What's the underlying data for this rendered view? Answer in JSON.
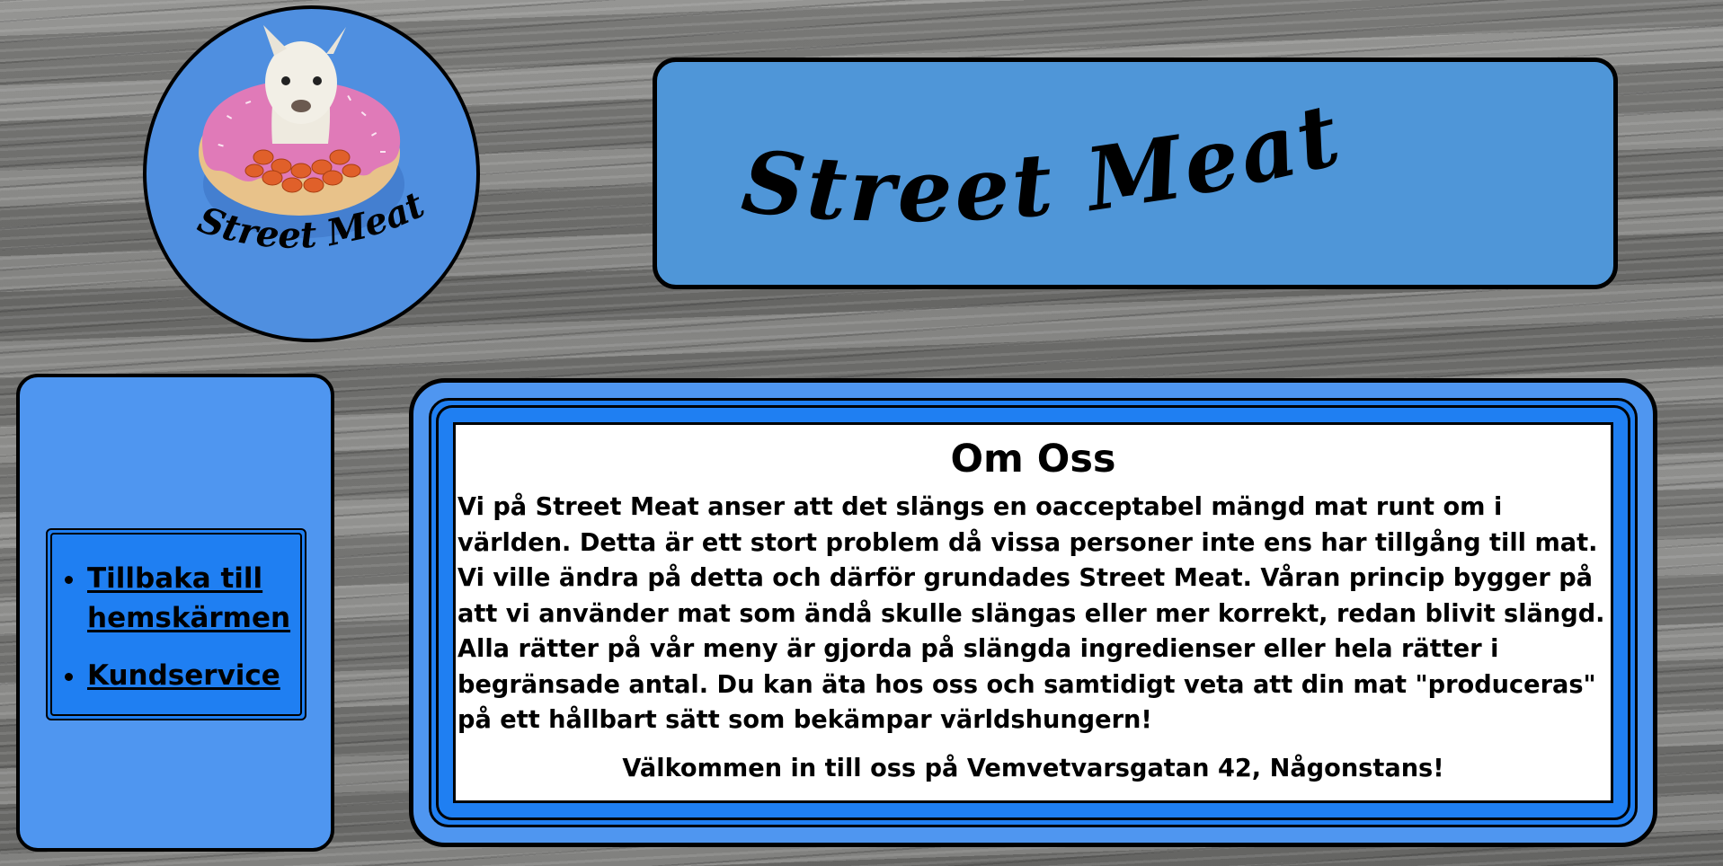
{
  "logo": {
    "text": "Street Meat",
    "image": "alpaca-in-donut-with-beans-icon"
  },
  "header": {
    "title": "Street Meat"
  },
  "nav": {
    "items": [
      {
        "label": "Tillbaka till hemskärmen"
      },
      {
        "label": "Kundservice"
      }
    ]
  },
  "about": {
    "title": "Om Oss",
    "text": "Vi på Street Meat anser att det slängs en oacceptabel mängd mat runt om i världen. Detta är ett stort problem då vissa personer inte ens har tillgång till mat. Vi ville ändra på detta och därför grundades Street Meat. Våran princip bygger på att vi använder mat som ändå skulle slängas eller mer korrekt, redan blivit slängd. Alla rätter på vår meny är gjorda på slängda ingredienser eller hela rätter i begränsade antal. Du kan äta hos oss och samtidigt veta att din mat \"produceras\" på ett hållbart sätt som bekämpar världshungern!",
    "welcome": "Välkommen in till oss på Vemvetvarsgatan 42, Någonstans!"
  },
  "colors": {
    "light_blue": "#4f96f0",
    "bright_blue": "#1f7ff2",
    "header_blue": "#4f96d8",
    "border": "#000000",
    "panel": "#ffffff"
  }
}
